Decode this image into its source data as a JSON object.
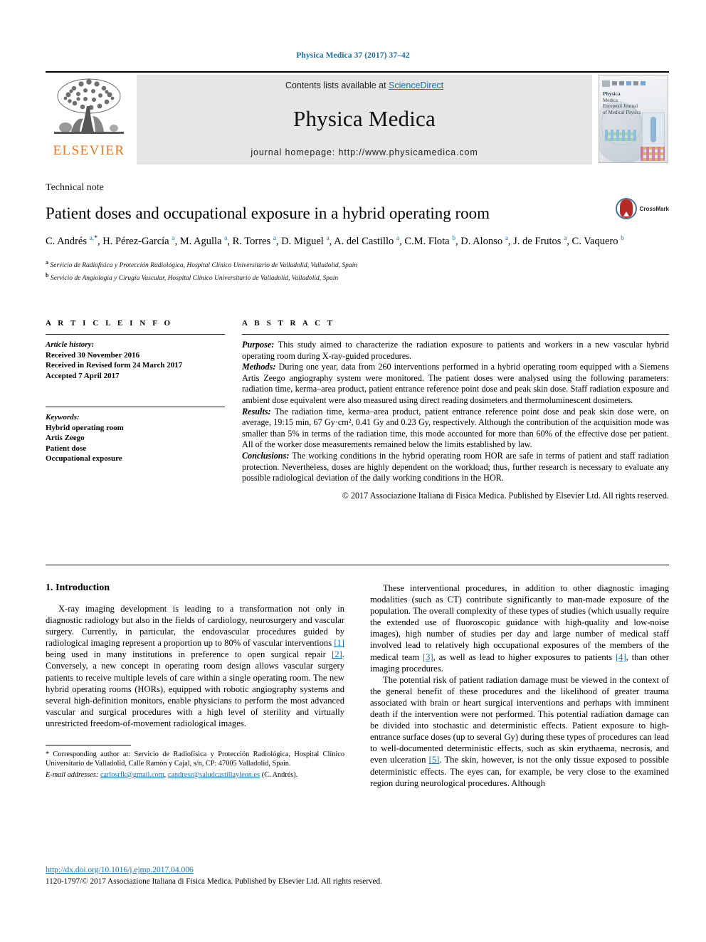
{
  "running_head": "Physica Medica 37 (2017) 37–42",
  "masthead": {
    "contents_prefix": "Contents lists available at ",
    "sciencedirect": "ScienceDirect",
    "journal_title": "Physica Medica",
    "homepage": "journal homepage: http://www.physicamedica.com",
    "publisher_logo": "ELSEVIER",
    "cover": {
      "line1": "Physica",
      "line2": "Medica",
      "line3": "European Journal",
      "line4": "of Medical Physics"
    }
  },
  "article": {
    "type": "Technical note",
    "title": "Patient doses and occupational exposure in a hybrid operating room",
    "crossmark_label": "CrossMark",
    "authors_html": "C. Andrés <sup class=\"aff-link\">a,<span class=\"star\">*</span></sup>, H. Pérez-García <sup class=\"aff-link\">a</sup>, M. Agulla <sup class=\"aff-link\">a</sup>, R. Torres <sup class=\"aff-link\">a</sup>, D. Miguel <sup class=\"aff-link\">a</sup>, A. del Castillo <sup class=\"aff-link\">a</sup>, C.M. Flota <sup class=\"aff-link\">b</sup>, D. Alonso <sup class=\"aff-link\">a</sup>, J. de Frutos <sup class=\"aff-link\">a</sup>, C. Vaquero <sup class=\"aff-link\">b</sup>",
    "affiliation_a": "Servicio de Radiofísica y Protección Radiológica, Hospital Clínico Universitario de Valladolid, Valladolid, Spain",
    "affiliation_b": "Servicio de Angiología y Cirugía Vascular, Hospital Clínico Universitario de Valladolid, Valladolid, Spain"
  },
  "article_info": {
    "heading": "A R T I C L E   I N F O",
    "history_label": "Article history:",
    "received": "Received 30 November 2016",
    "revised": "Received in Revised form 24 March 2017",
    "accepted": "Accepted 7 April 2017",
    "keywords_label": "Keywords:",
    "keywords": [
      "Hybrid operating room",
      "Artis Zeego",
      "Patient dose",
      "Occupational exposure"
    ]
  },
  "abstract": {
    "heading": "A B S T R A C T",
    "purpose_label": "Purpose:",
    "purpose": " This study aimed to characterize the radiation exposure to patients and workers in a new vascular hybrid operating room during X-ray-guided procedures.",
    "methods_label": "Methods:",
    "methods": " During one year, data from 260 interventions performed in a hybrid operating room equipped with a Siemens Artis Zeego angiography system were monitored. The patient doses were analysed using the following parameters: radiation time, kerma–area product, patient entrance reference point dose and peak skin dose. Staff radiation exposure and ambient dose equivalent were also measured using direct reading dosimeters and thermoluminescent dosimeters.",
    "results_label": "Results:",
    "results": " The radiation time, kerma–area product, patient entrance reference point dose and peak skin dose were, on average, 19:15 min, 67 Gy·cm², 0.41 Gy and 0.23 Gy, respectively. Although the contribution of the acquisition mode was smaller than 5% in terms of the radiation time, this mode accounted for more than 60% of the effective dose per patient. All of the worker dose measurements remained below the limits established by law.",
    "conclusions_label": "Conclusions:",
    "conclusions": " The working conditions in the hybrid operating room HOR are safe in terms of patient and staff radiation protection. Nevertheless, doses are highly dependent on the workload; thus, further research is necessary to evaluate any possible radiological deviation of the daily working conditions in the HOR.",
    "copyright": "© 2017 Associazione Italiana di Fisica Medica. Published by Elsevier Ltd. All rights reserved."
  },
  "body": {
    "section_heading": "1. Introduction",
    "left_p1_a": "X-ray imaging development is leading to a transformation not only in diagnostic radiology but also in the fields of cardiology, neurosurgery and vascular surgery. Currently, in particular, the endovascular procedures guided by radiological imaging represent a proportion up to 80% of vascular interventions ",
    "left_p1_ref1": "[1]",
    "left_p1_b": " being used in many institutions in preference to open surgical repair ",
    "left_p1_ref2": "[2]",
    "left_p1_c": ". Conversely, a new concept in operating room design allows vascular surgery patients to receive multiple levels of care within a single operating room. The new hybrid operating rooms (HORs), equipped with robotic angiography systems and several high-definition monitors, enable physicians to perform the most advanced vascular and surgical procedures with a high level of sterility and virtually unrestricted freedom-of-movement radiological images.",
    "right_p1_a": "These interventional procedures, in addition to other diagnostic imaging modalities (such as CT) contribute significantly to man-made exposure of the population. The overall complexity of these types of studies (which usually require the extended use of fluoroscopic guidance with high-quality and low-noise images), high number of studies per day and large number of medical staff involved lead to relatively high occupational exposures of the members of the medical team ",
    "right_p1_ref3": "[3]",
    "right_p1_b": ", as well as lead to higher exposures to patients ",
    "right_p1_ref4": "[4]",
    "right_p1_c": ", than other imaging procedures.",
    "right_p2_a": "The potential risk of patient radiation damage must be viewed in the context of the general benefit of these procedures and the likelihood of greater trauma associated with brain or heart surgical interventions and perhaps with imminent death if the intervention were not performed. This potential radiation damage can be divided into stochastic and deterministic effects. Patient exposure to high-entrance surface doses (up to several Gy) during these types of procedures can lead to well-documented deterministic effects, such as skin erythaema, necrosis, and even ulceration ",
    "right_p2_ref5": "[5]",
    "right_p2_b": ". The skin, however, is not the only tissue exposed to possible deterministic effects. The eyes can, for example, be very close to the examined region during neurological procedures. Although"
  },
  "footnote": {
    "corresponding": "* Corresponding author at: Servicio de Radiofísica y Protección Radiológica, Hospital Clínico Universitario de Valladolid, Calle Ramón y Cajal, s/n, CP: 47005 Valladolid, Spain.",
    "email_label": "E-mail addresses:",
    "email1": "carlosrfk@gmail.com",
    "email_sep": ", ",
    "email2": "candresr@saludcastillayleon.es",
    "email_attr": "(C. Andrés)."
  },
  "bottom": {
    "doi": "http://dx.doi.org/10.1016/j.ejmp.2017.04.006",
    "issn_copyright": "1120-1797/© 2017 Associazione Italiana di Fisica Medica. Published by Elsevier Ltd. All rights reserved."
  },
  "colors": {
    "link": "#1c6ea4",
    "elsevier_orange": "#E87722",
    "masthead_bg": "#e6e6e6"
  }
}
